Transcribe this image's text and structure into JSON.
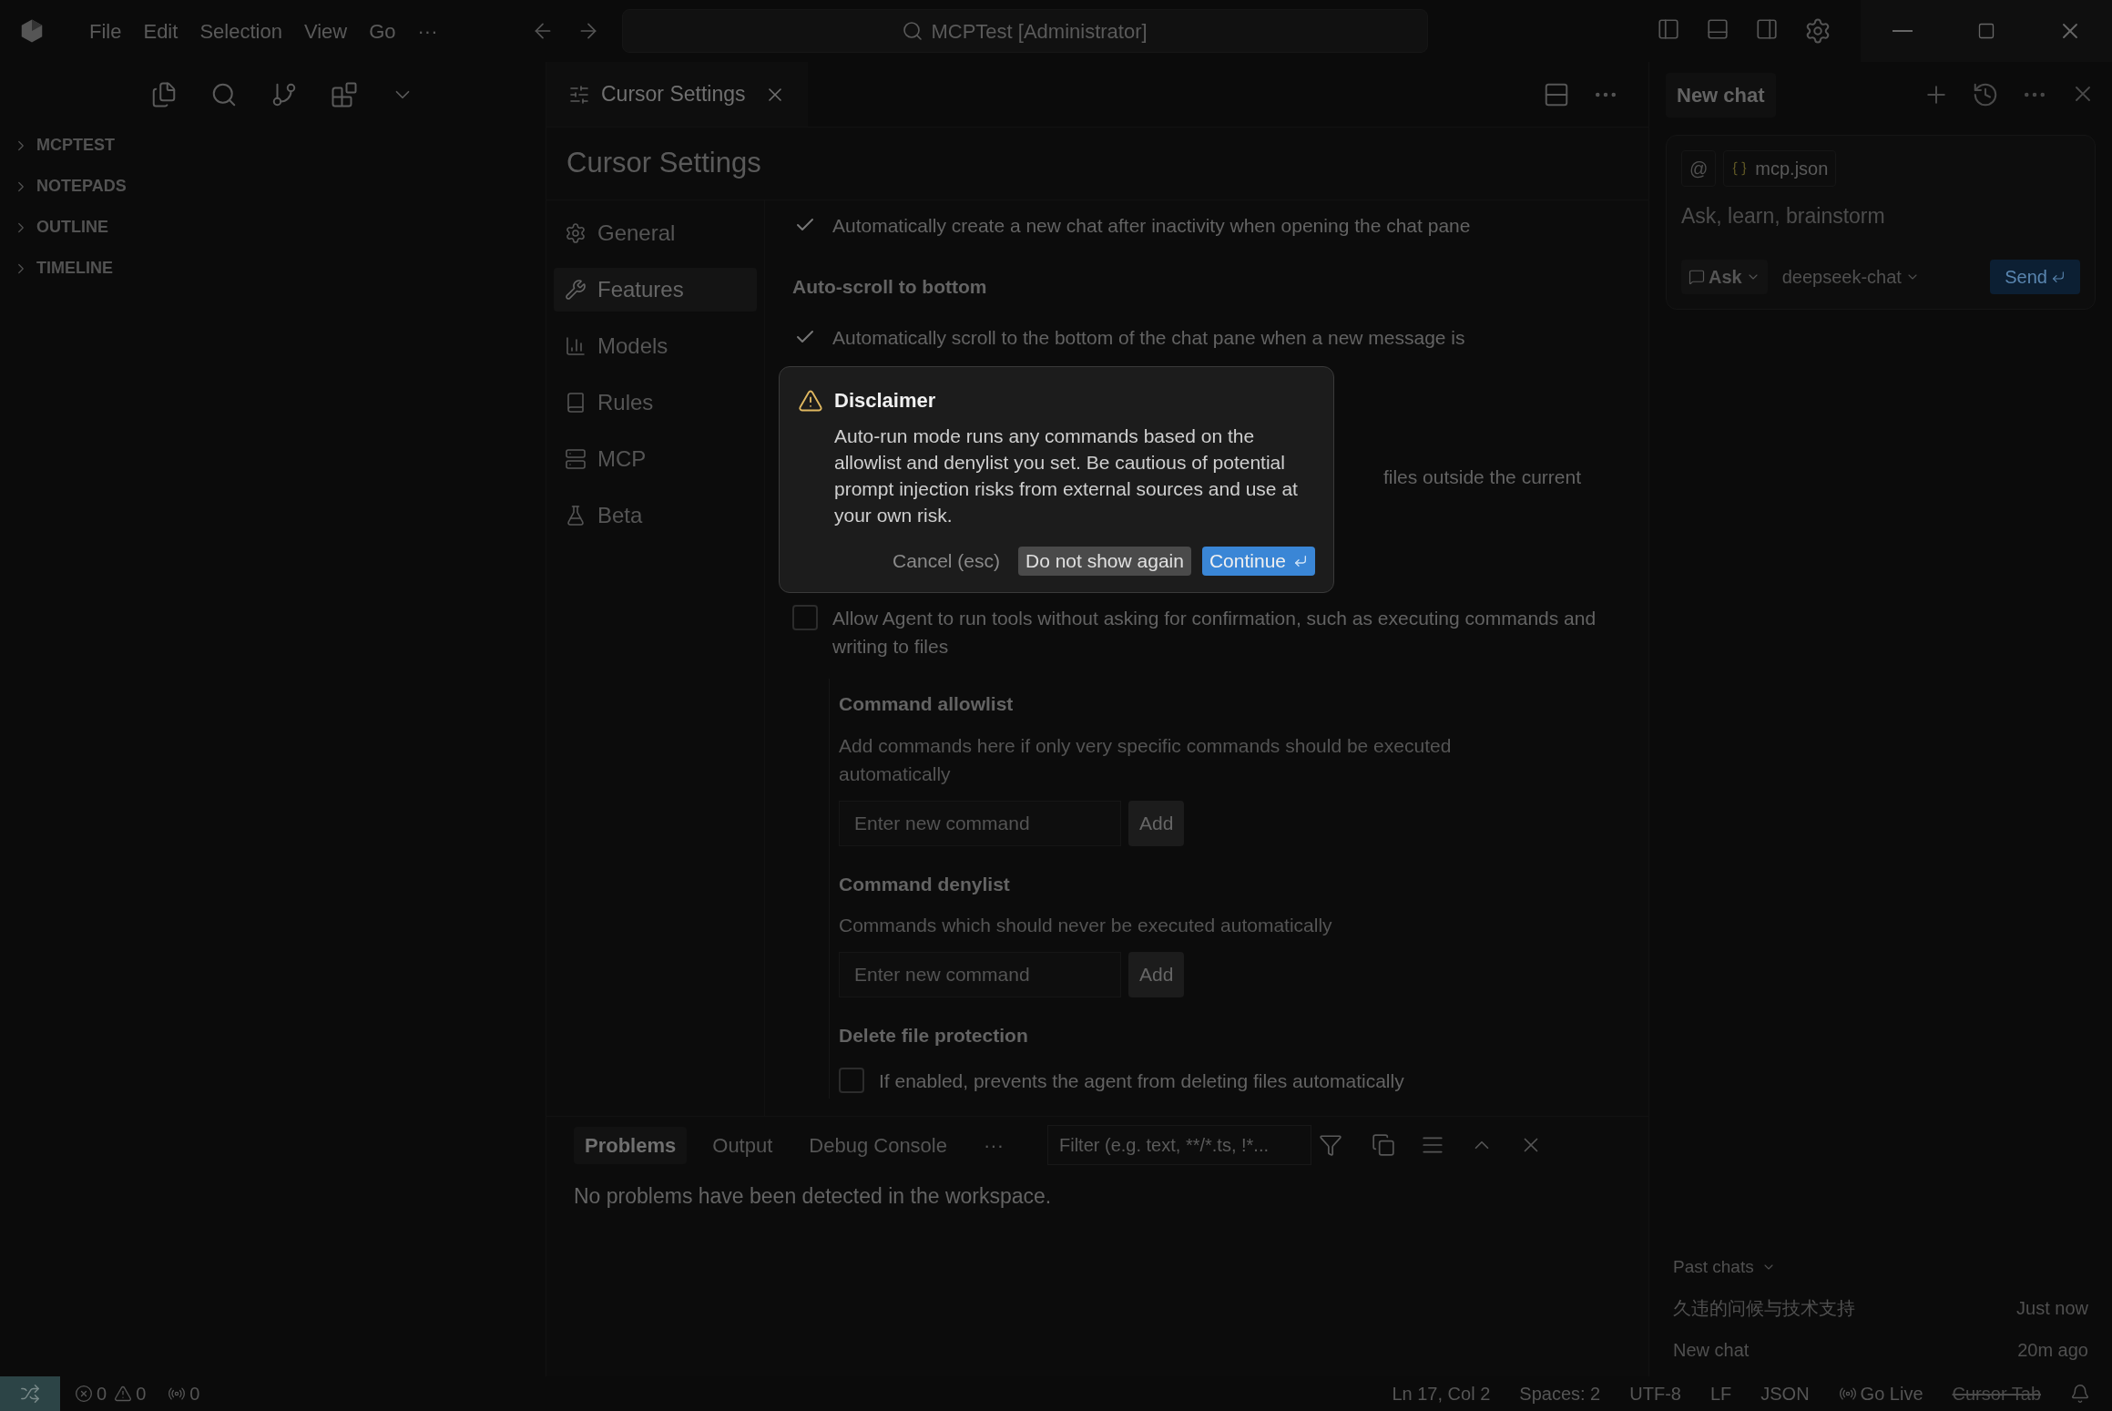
{
  "title_bar": {
    "menu": [
      "File",
      "Edit",
      "Selection",
      "View",
      "Go",
      "···"
    ],
    "title": "MCPTest [Administrator]"
  },
  "explorer": {
    "sections": [
      {
        "label": "MCPTEST",
        "expanded": false
      },
      {
        "label": "NOTEPADS",
        "expanded": false
      },
      {
        "label": "OUTLINE",
        "expanded": false
      },
      {
        "label": "TIMELINE",
        "expanded": false
      }
    ]
  },
  "editor": {
    "tab": {
      "label": "Cursor Settings"
    },
    "settings": {
      "title": "Cursor Settings",
      "nav": [
        {
          "label": "General",
          "selected": false
        },
        {
          "label": "Features",
          "selected": true
        },
        {
          "label": "Models",
          "selected": false
        },
        {
          "label": "Rules",
          "selected": false
        },
        {
          "label": "MCP",
          "selected": false
        },
        {
          "label": "Beta",
          "selected": false
        }
      ],
      "items": [
        {
          "kind": "checkbox",
          "checked": true,
          "text": "Automatically create a new chat after inactivity when opening the chat pane"
        },
        {
          "kind": "heading",
          "text": "Auto-scroll to bottom"
        },
        {
          "kind": "checkbox",
          "checked": true,
          "text": "Automatically scroll to the bottom of the chat pane when a new message is"
        },
        {
          "kind": "fragment",
          "text": "files outside the current"
        },
        {
          "kind": "checkbox",
          "checked": false,
          "text": "Allow Agent to run tools without asking for confirmation, such as executing commands and writing to files",
          "children": [
            {
              "kind": "heading",
              "text": "Command allowlist"
            },
            {
              "kind": "description",
              "text": "Add commands here if only very specific commands should be executed automatically"
            },
            {
              "kind": "input",
              "placeholder": "Enter new command",
              "button": "Add"
            },
            {
              "kind": "heading",
              "text": "Command denylist"
            },
            {
              "kind": "description",
              "text": "Commands which should never be executed automatically"
            },
            {
              "kind": "input",
              "placeholder": "Enter new command",
              "button": "Add"
            },
            {
              "kind": "heading",
              "text": "Delete file protection"
            },
            {
              "kind": "checkbox",
              "checked": false,
              "text": "If enabled, prevents the agent from deleting files automatically"
            }
          ]
        }
      ]
    }
  },
  "dialog": {
    "title": "Disclaimer",
    "body": "Auto-run mode runs any commands based on the allowlist and denylist you set. Be cautious of potential prompt injection risks from external sources and use at your own risk.",
    "buttons": [
      {
        "kind": "text",
        "label": "Cancel (esc)"
      },
      {
        "kind": "secondary",
        "label": "Do not show again"
      },
      {
        "kind": "primary",
        "label": "Continue"
      }
    ]
  },
  "panel": {
    "tabs": [
      {
        "label": "Problems",
        "selected": true
      },
      {
        "label": "Output",
        "selected": false
      },
      {
        "label": "Debug Console",
        "selected": false
      }
    ],
    "more": "···",
    "filter": {
      "placeholder": "Filter (e.g. text, **/*.ts, !*..."
    },
    "message": "No problems have been detected in the workspace."
  },
  "chat": {
    "tab": "New chat",
    "context": {
      "at": "@",
      "file": "mcp.json"
    },
    "input": {
      "placeholder": "Ask, learn, brainstorm"
    },
    "mode": "Ask",
    "model": "deepseek-chat",
    "send": "Send",
    "past_chats": {
      "title": "Past chats",
      "items": [
        {
          "title": "久违的问候与技术支持",
          "time": "Just now"
        },
        {
          "title": "New chat",
          "time": "20m ago"
        }
      ]
    }
  },
  "status_bar": {
    "errors": "0",
    "warnings": "0",
    "ports": "0",
    "right": [
      "Ln 17, Col 2",
      "Spaces: 2",
      "UTF-8",
      "LF",
      "JSON"
    ],
    "go_live": "Go Live",
    "cursor_tab": "Cursor Tab"
  }
}
